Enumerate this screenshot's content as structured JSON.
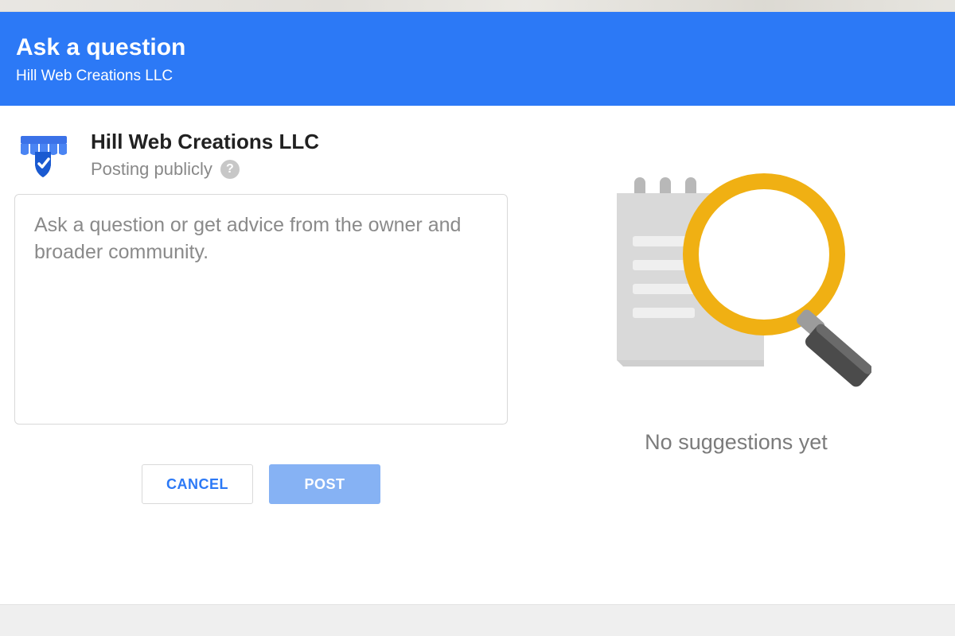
{
  "header": {
    "title": "Ask a question",
    "subtitle": "Hill Web Creations LLC"
  },
  "posting": {
    "business_name": "Hill Web Creations LLC",
    "status_label": "Posting publicly",
    "help_glyph": "?"
  },
  "textarea": {
    "value": "",
    "placeholder": "Ask a question or get advice from the owner and broader community."
  },
  "buttons": {
    "cancel_label": "CANCEL",
    "post_label": "POST"
  },
  "suggestions": {
    "empty_label": "No suggestions yet"
  },
  "colors": {
    "primary": "#2c79f6",
    "post_disabled": "#86b2f4",
    "magnifier_ring": "#f0b013",
    "notepad": "#d9d9d9"
  }
}
